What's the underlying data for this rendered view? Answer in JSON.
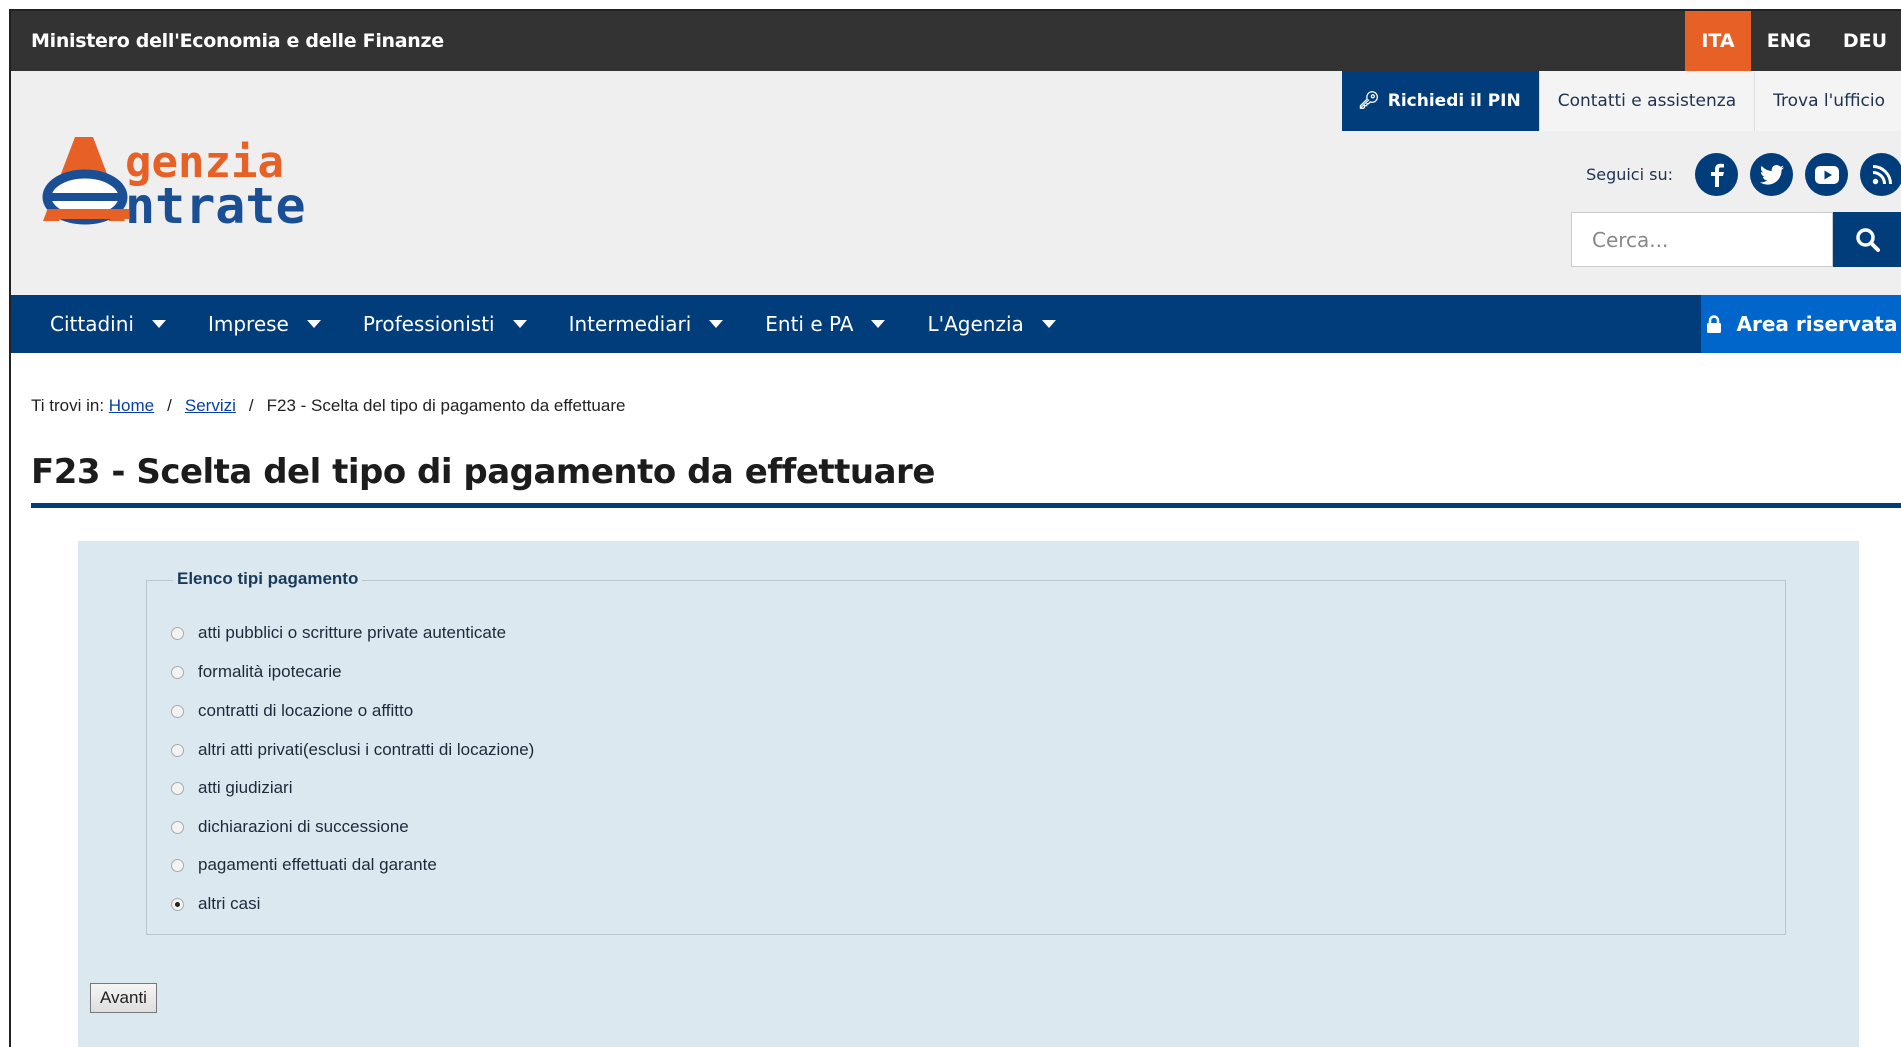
{
  "topbar": {
    "ministry": "Ministero dell'Economia e delle Finanze",
    "languages": [
      {
        "label": "ITA",
        "active": true
      },
      {
        "label": "ENG",
        "active": false
      },
      {
        "label": "DEU",
        "active": false
      }
    ]
  },
  "header": {
    "logo": {
      "line1": "genzia",
      "line2": "ntrate"
    },
    "pin_label": "Richiedi il PIN",
    "links": [
      "Contatti e assistenza",
      "Trova l'ufficio"
    ],
    "follow_label": "Seguici su:",
    "social_icons": [
      "facebook-icon",
      "twitter-icon",
      "youtube-icon",
      "rss-icon"
    ],
    "search_placeholder": "Cerca..."
  },
  "nav": {
    "items": [
      "Cittadini",
      "Imprese",
      "Professionisti",
      "Intermediari",
      "Enti e PA",
      "L'Agenzia"
    ],
    "reserved_area": "Area riservata"
  },
  "breadcrumb": {
    "prefix": "Ti trovi in:",
    "items": [
      "Home",
      "Servizi"
    ],
    "current": "F23 - Scelta del tipo di pagamento da effettuare",
    "separator": "/"
  },
  "page_title": "F23 - Scelta del tipo di pagamento da effettuare",
  "form": {
    "legend": "Elenco tipi pagamento",
    "options": [
      {
        "label": "atti pubblici o scritture private autenticate",
        "selected": false
      },
      {
        "label": "formalità ipotecarie",
        "selected": false
      },
      {
        "label": "contratti di locazione o affitto",
        "selected": false
      },
      {
        "label": "altri atti privati(esclusi i contratti di locazione)",
        "selected": false
      },
      {
        "label": "atti giudiziari",
        "selected": false
      },
      {
        "label": "dichiarazioni di successione",
        "selected": false
      },
      {
        "label": "pagamenti effettuati dal garante",
        "selected": false
      },
      {
        "label": "altri casi",
        "selected": true
      }
    ],
    "submit_label": "Avanti"
  },
  "colors": {
    "brand_blue": "#003d7a",
    "accent_orange": "#e76126",
    "reserved_blue": "#0066cc",
    "panel_bg": "#dbe8f0"
  }
}
